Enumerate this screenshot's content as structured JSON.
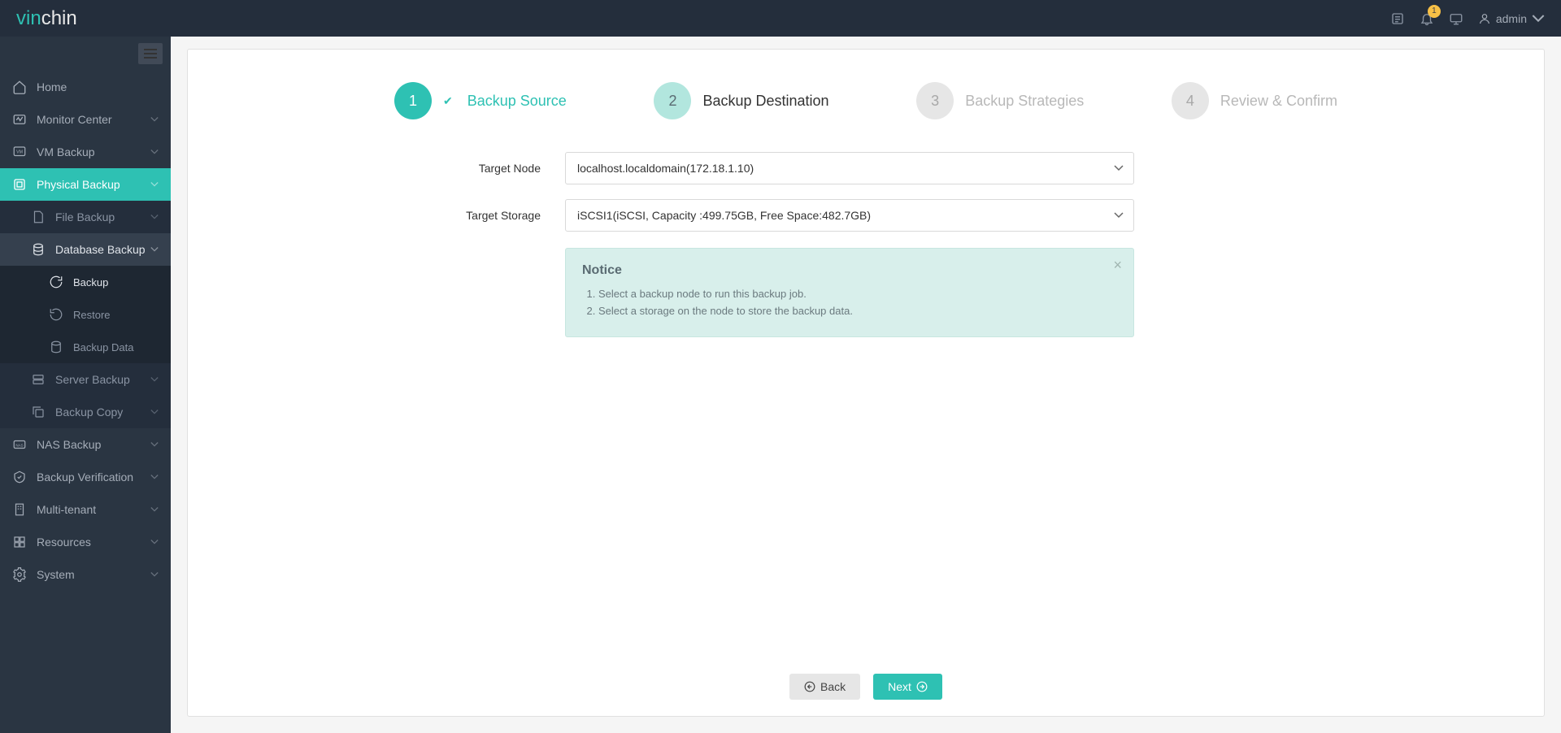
{
  "brand": {
    "part1": "vin",
    "part2": "chin"
  },
  "header": {
    "notif_count": "1",
    "username": "admin"
  },
  "sidebar": {
    "home": "Home",
    "monitor": "Monitor Center",
    "vm_backup": "VM Backup",
    "physical_backup": "Physical Backup",
    "file_backup": "File Backup",
    "database_backup": "Database Backup",
    "db_backup_sub": "Backup",
    "db_restore_sub": "Restore",
    "db_data_sub": "Backup Data",
    "server_backup": "Server Backup",
    "backup_copy": "Backup Copy",
    "nas_backup": "NAS Backup",
    "backup_verification": "Backup Verification",
    "multi_tenant": "Multi-tenant",
    "resources": "Resources",
    "system": "System"
  },
  "wizard": {
    "step1_num": "1",
    "step1_label": "Backup Source",
    "step2_num": "2",
    "step2_label": "Backup Destination",
    "step3_num": "3",
    "step3_label": "Backup Strategies",
    "step4_num": "4",
    "step4_label": "Review & Confirm"
  },
  "form": {
    "target_node_label": "Target Node",
    "target_node_value": "localhost.localdomain(172.18.1.10)",
    "target_storage_label": "Target Storage",
    "target_storage_value": "iSCSI1(iSCSI, Capacity :499.75GB, Free Space:482.7GB)"
  },
  "notice": {
    "title": "Notice",
    "item1": "Select a backup node to run this backup job.",
    "item2": "Select a storage on the node to store the backup data."
  },
  "buttons": {
    "back": "Back",
    "next": "Next"
  }
}
